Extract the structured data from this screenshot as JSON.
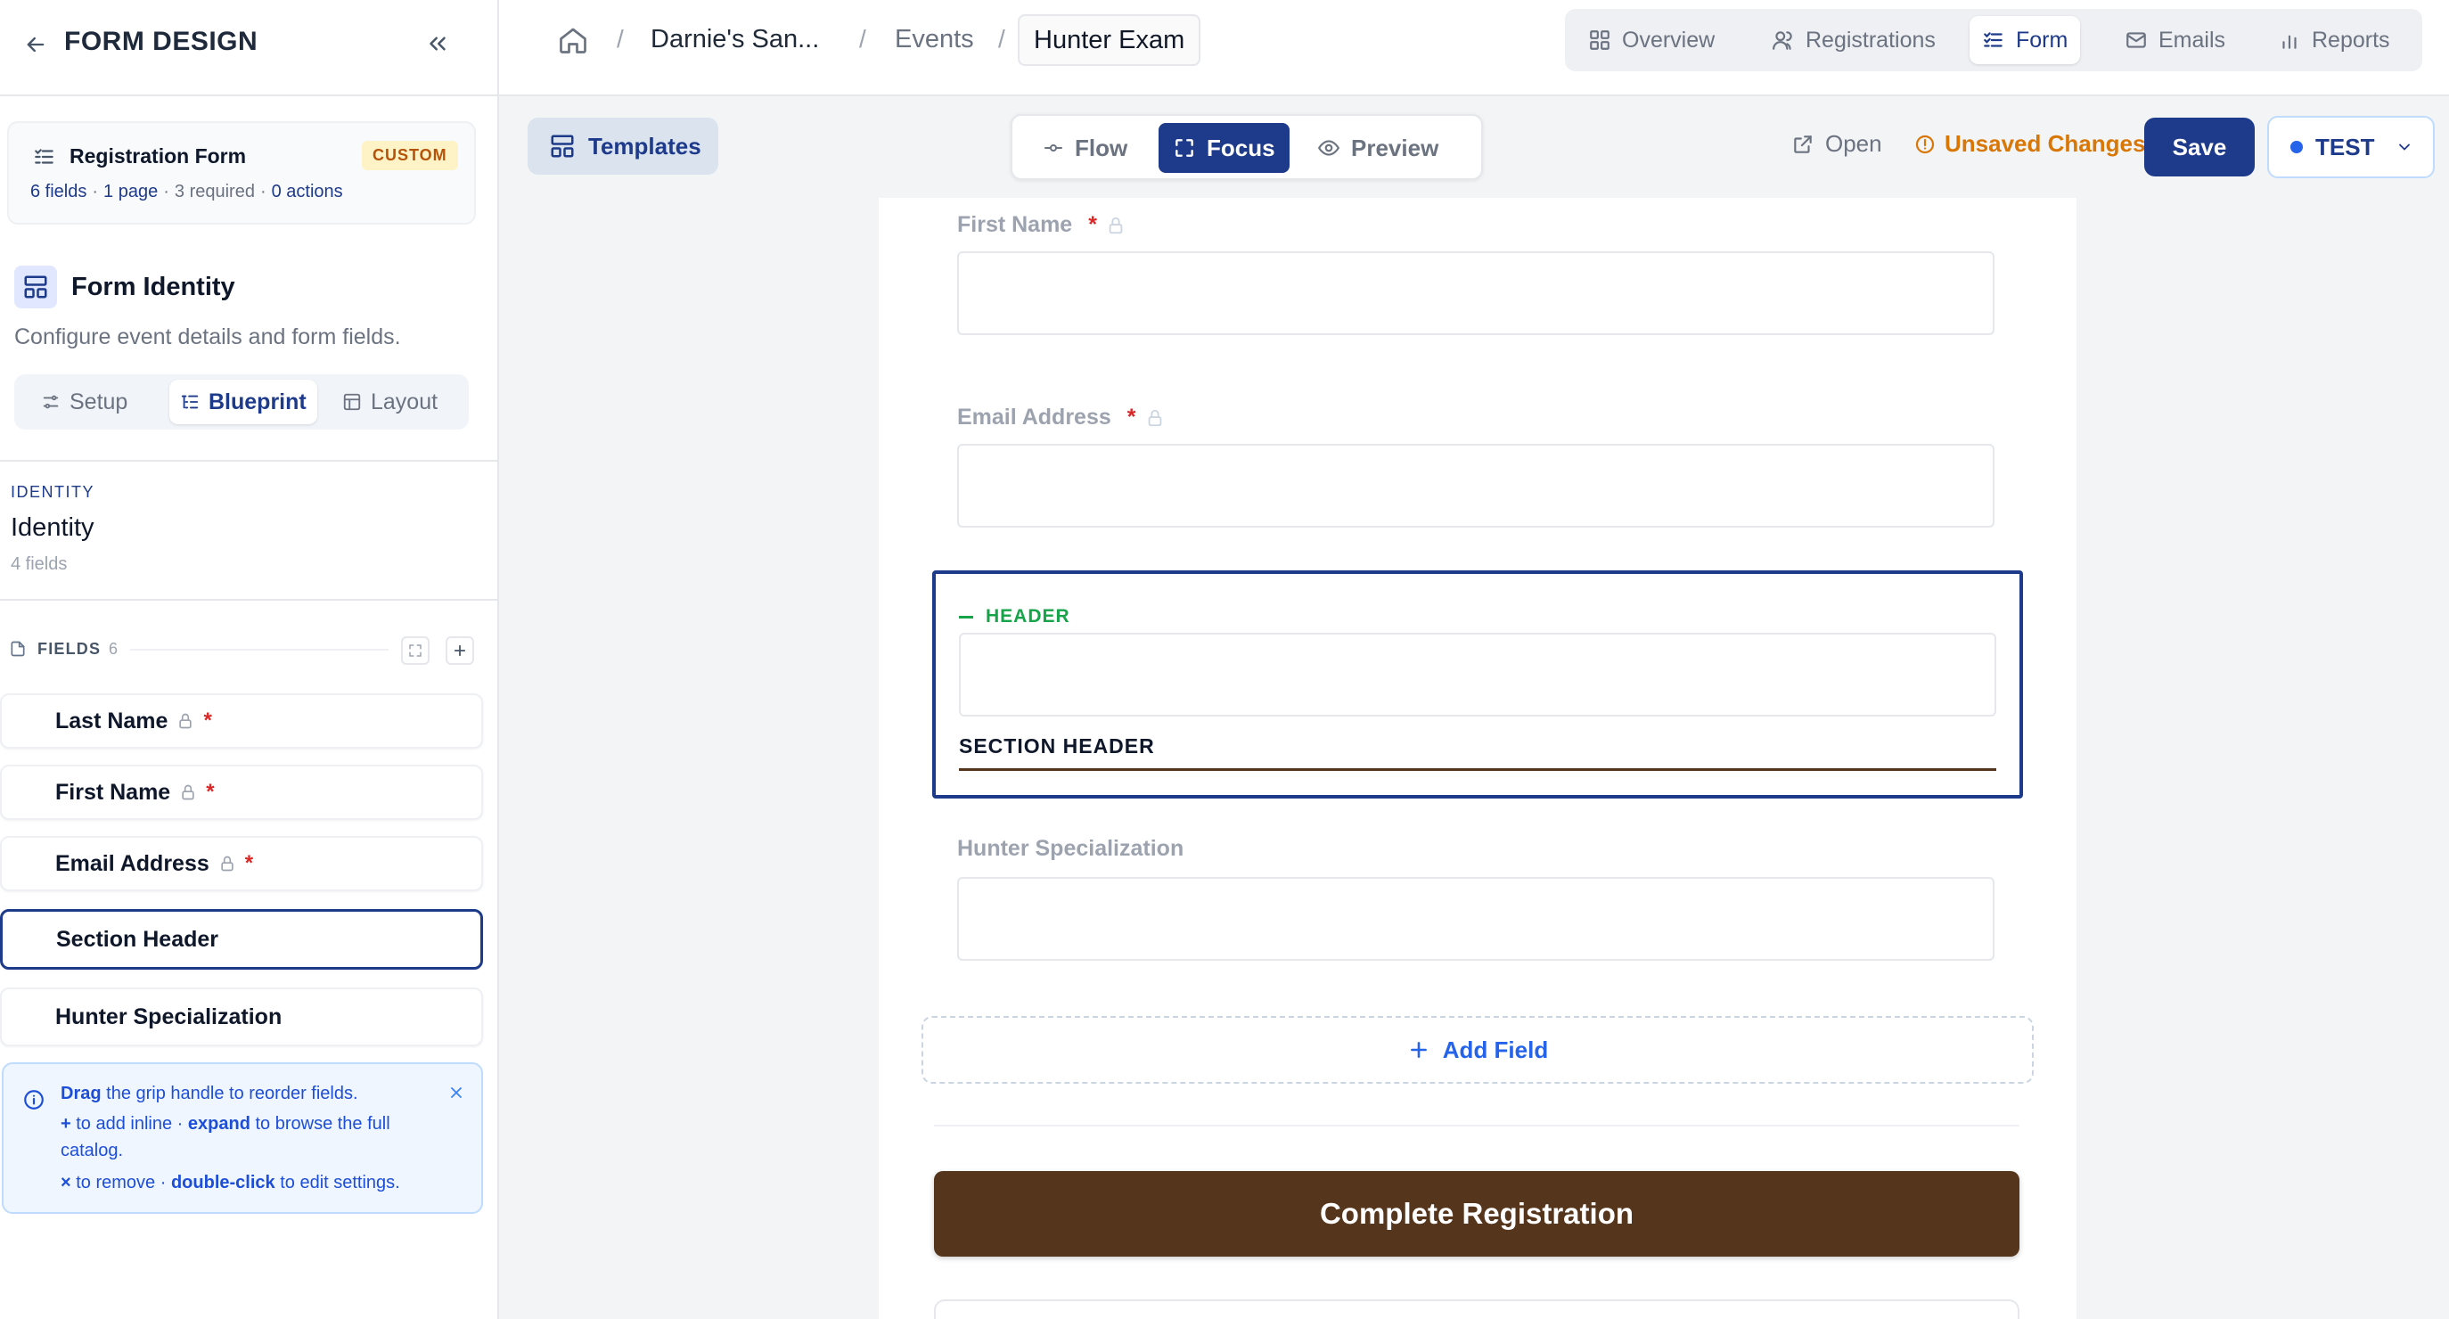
{
  "sidebar": {
    "title": "FORM DESIGN",
    "form_card": {
      "name": "Registration Form",
      "badge": "CUSTOM",
      "stat_fields": "6 fields",
      "stat_pages": "1 page",
      "stat_required": "3 required",
      "stat_actions": "0 actions",
      "sep": "·"
    },
    "identity_heading": "Form Identity",
    "identity_desc": "Configure event details and form fields.",
    "segments": [
      "Setup",
      "Blueprint",
      "Layout"
    ],
    "section_kicker": "IDENTITY",
    "section_name": "Identity",
    "section_count": "4 fields",
    "fields_label": "FIELDS",
    "fields_count": "6",
    "fields": [
      {
        "label": "Last Name",
        "locked": true,
        "required": true
      },
      {
        "label": "First Name",
        "locked": true,
        "required": true
      },
      {
        "label": "Email Address",
        "locked": true,
        "required": true
      },
      {
        "label": "Section Header",
        "locked": false,
        "required": false,
        "selected": true
      },
      {
        "label": "Hunter Specialization",
        "locked": false,
        "required": false
      }
    ],
    "required_mark": "*",
    "tip": {
      "l1_bold": "Drag",
      "l1_rest": " the grip handle to reorder fields.",
      "l2_a": "+",
      "l2_b": " to add inline · ",
      "l2_c": "expand",
      "l2_d": " to browse the full",
      "l3": "catalog.",
      "l4_a": "×",
      "l4_b": " to remove · ",
      "l4_c": "double-click",
      "l4_d": " to edit settings."
    }
  },
  "topbar": {
    "breadcrumb": [
      "Darnie's San...",
      "Events",
      "Hunter Exam"
    ],
    "separator": "/",
    "tabs": [
      "Overview",
      "Registrations",
      "Form",
      "Emails",
      "Reports"
    ],
    "active_tab": "Form"
  },
  "toolbar": {
    "templates": "Templates",
    "modes": [
      "Flow",
      "Focus",
      "Preview"
    ],
    "active_mode": "Focus",
    "open": "Open",
    "unsaved": "Unsaved Changes",
    "save": "Save",
    "env": "TEST"
  },
  "form": {
    "fields": [
      {
        "label": "First Name",
        "required": true,
        "locked": true
      },
      {
        "label": "Email Address",
        "required": true,
        "locked": true
      }
    ],
    "header_kicker": "HEADER",
    "section_header": "SECTION HEADER",
    "hunter_field": "Hunter Specialization",
    "add_field": "Add Field",
    "submit": "Complete Registration"
  },
  "colors": {
    "brand_navy": "#1e3a8a",
    "submit_brown": "#55351b",
    "warning": "#d97706",
    "required": "#dc2626",
    "header_green": "#16a34a"
  }
}
